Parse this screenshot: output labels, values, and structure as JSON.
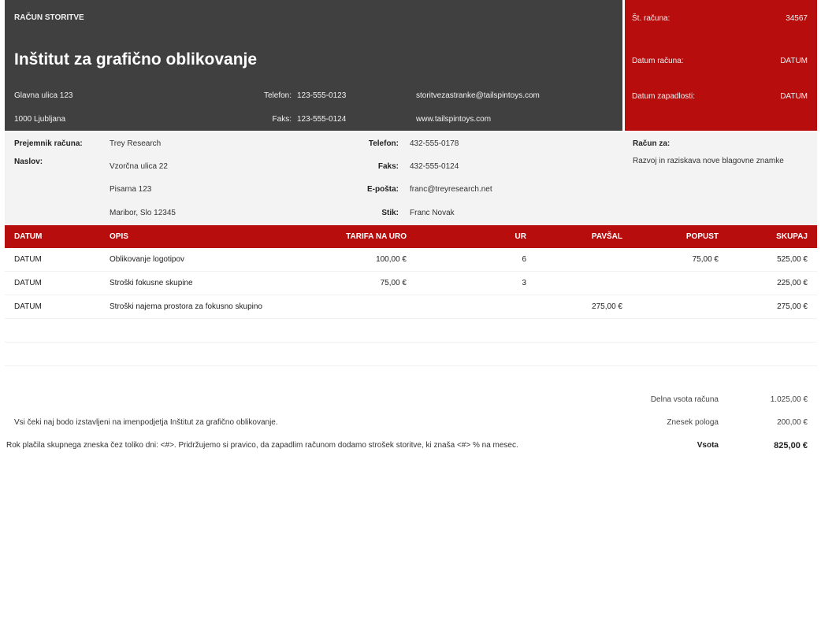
{
  "header": {
    "doc_type": "RAČUN STORITVE",
    "company": "Inštitut za grafično oblikovanje",
    "address_line1": "Glavna ulica 123",
    "address_line2": "1000 Ljubljana",
    "phone_label": "Telefon:",
    "phone": "123-555-0123",
    "fax_label": "Faks:",
    "fax": "123-555-0124",
    "email": "storitvezastranke@tailspintoys.com",
    "website": "www.tailspintoys.com"
  },
  "invoice_meta": {
    "number_label": "Št. računa:",
    "number": "34567",
    "date_label": "Datum računa:",
    "date": "DATUM",
    "due_label": "Datum zapadlosti:",
    "due": "DATUM"
  },
  "recipient": {
    "name_label": "Prejemnik računa:",
    "name": "Trey Research",
    "address_label": "Naslov:",
    "address_line1": "Vzorčna ulica 22",
    "address_line2": "Pisarna 123",
    "address_line3": "Maribor, Slo 12345",
    "phone_label": "Telefon:",
    "phone": "432-555-0178",
    "fax_label": "Faks:",
    "fax": "432-555-0124",
    "email_label": "E-pošta:",
    "email": "franc@treyresearch.net",
    "contact_label": "Stik:",
    "contact": "Franc Novak",
    "bill_for_label": "Račun za:",
    "bill_for": "Razvoj in raziskava nove blagovne znamke"
  },
  "table": {
    "columns": [
      "DATUM",
      "OPIS",
      "TARIFA NA URO",
      "UR",
      "PAVŠAL",
      "POPUST",
      "SKUPAJ"
    ],
    "rows": [
      [
        "DATUM",
        "Oblikovanje logotipov",
        "100,00 €",
        "6",
        "",
        "75,00 €",
        "525,00 €"
      ],
      [
        "DATUM",
        "Stroški fokusne skupine",
        "75,00 €",
        "3",
        "",
        "",
        "225,00 €"
      ],
      [
        "DATUM",
        "Stroški najema prostora za fokusno skupino",
        "",
        "",
        "275,00 €",
        "",
        "275,00 €"
      ]
    ]
  },
  "totals": {
    "subtotal_label": "Delna vsota računa",
    "subtotal": "1.025,00 €",
    "deposit_label": "Znesek pologa",
    "deposit": "200,00 €",
    "total_label": "Vsota",
    "total": "825,00 €"
  },
  "notes": {
    "line1": "Vsi čeki naj bodo izstavljeni na imenpodjetja Inštitut za grafično oblikovanje.",
    "line2": "Rok plačila skupnega zneska čez toliko dni: <#>. Pridržujemo si pravico, da zapadlim računom dodamo strošek storitve, ki znaša <#> % na mesec."
  },
  "colors": {
    "dark": "#404040",
    "accent": "#b70d0d",
    "band": "#f3f3f3"
  }
}
